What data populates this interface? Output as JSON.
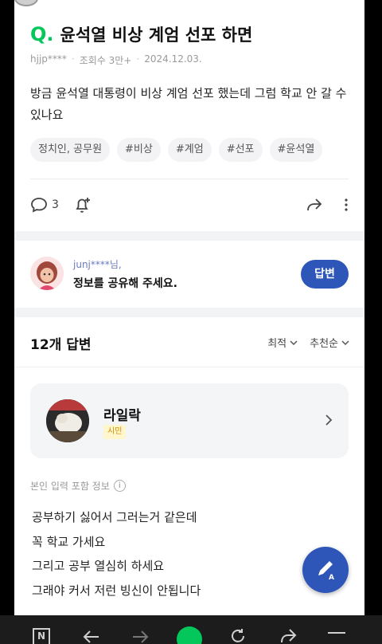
{
  "question": {
    "q_mark": "Q.",
    "title": "윤석열 비상 계엄 선포 하면",
    "author": "hjjp****",
    "views": "조회수 3만+",
    "date": "2024.12.03.",
    "body_line1": "방금 윤석열 대통령이 비상 계엄 선포 했는데 그럼 학교 안 갈 수",
    "body_line2": "있나요",
    "tags": [
      "정치인, 공무원",
      "#비상",
      "#계엄",
      "#선포",
      "#윤석열"
    ],
    "comment_count": "3"
  },
  "prompt": {
    "user": "junj****님,",
    "text": "정보를 공유해 주세요.",
    "answer_button": "답변"
  },
  "answers_header": {
    "count_label": "12개 답변",
    "sort_latest": "최적",
    "sort_recommended": "추천순"
  },
  "answer_card": {
    "name": "라일락",
    "badge": "시민"
  },
  "answer": {
    "info_label": "본인 입력 포함 정보",
    "info_icon": "i",
    "lines": [
      "공부하기 싫어서 그러는거 같은데",
      "꼭 학교 가세요",
      "그리고 공부 열심히 하세요",
      "그래야 커서 저런 빙신이 안됩니다"
    ]
  },
  "nav": {
    "logo": "N"
  },
  "colors": {
    "brand_green": "#03c75a",
    "primary_blue": "#2d56b8",
    "badge_yellow": "#d08a00"
  }
}
